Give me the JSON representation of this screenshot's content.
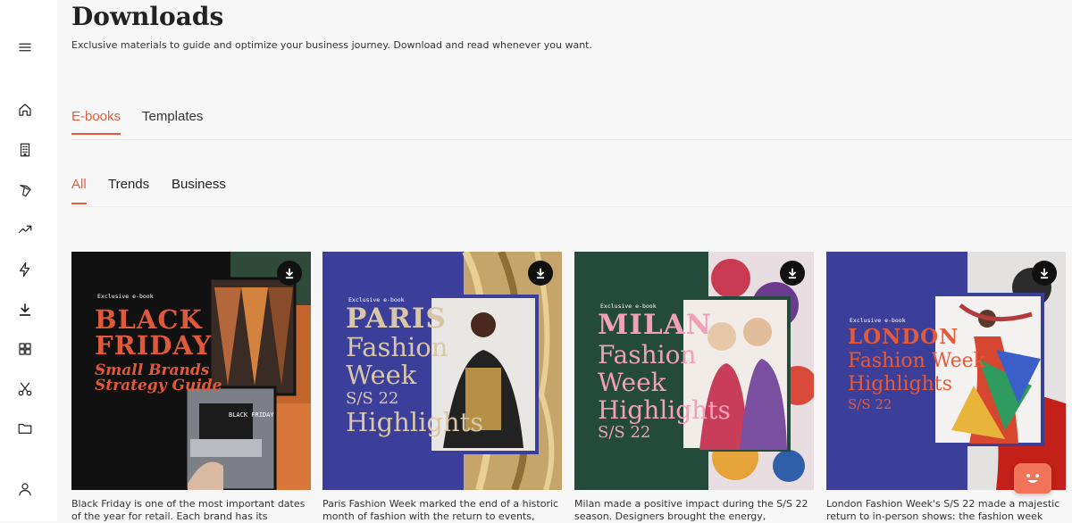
{
  "page": {
    "title": "Downloads",
    "subtitle": "Exclusive materials to guide and optimize your business journey. Download and read whenever you want."
  },
  "sidebar": {
    "items": [
      {
        "icon": "menu-icon"
      },
      {
        "icon": "home-icon"
      },
      {
        "icon": "building-icon"
      },
      {
        "icon": "hanger-icon"
      },
      {
        "icon": "trending-icon"
      },
      {
        "icon": "flash-icon"
      },
      {
        "icon": "download-icon"
      },
      {
        "icon": "grid-icon"
      },
      {
        "icon": "scissors-icon"
      },
      {
        "icon": "folder-icon"
      },
      {
        "icon": "user-icon"
      }
    ]
  },
  "tabs": [
    {
      "label": "E-books",
      "active": true
    },
    {
      "label": "Templates",
      "active": false
    }
  ],
  "filters": [
    {
      "label": "All",
      "active": true
    },
    {
      "label": "Trends",
      "active": false
    },
    {
      "label": "Business",
      "active": false
    }
  ],
  "cards": [
    {
      "label": "Exclusive e-book",
      "heading": [
        "BLACK",
        "FRIDAY"
      ],
      "subheading": [
        "Small Brands",
        "Strategy Guide"
      ],
      "laptop_screen": "BLACK FRIDAY",
      "description": "Black Friday is one of the most important dates of the year for retail. Each brand has its",
      "colors": {
        "bg": "#111111",
        "accent": "#e0593a"
      }
    },
    {
      "label": "Exclusive e-book",
      "heading": [
        "PARIS"
      ],
      "subheading": [
        "Fashion",
        "Week",
        "S/S 22",
        "Highlights"
      ],
      "description": "Paris Fashion Week marked the end of a historic month of fashion with the return to events,",
      "colors": {
        "bg": "#3c3f9a",
        "accent": "#d9c9a8"
      }
    },
    {
      "label": "Exclusive e-book",
      "heading": [
        "MILAN"
      ],
      "subheading": [
        "Fashion",
        "Week",
        "Highlights",
        "S/S 22"
      ],
      "description": "Milan made a positive impact during the S/S 22 season. Designers brought the energy,",
      "colors": {
        "bg": "#234a3b",
        "accent": "#f2a0b8"
      }
    },
    {
      "label": "Exclusive e-book",
      "heading": [
        "LONDON"
      ],
      "subheading": [
        "Fashion Week",
        "Highlights",
        "S/S 22"
      ],
      "description": "London Fashion Week's S/S 22 made a majestic return to in-person shows: the fashion week",
      "colors": {
        "bg": "#3c3f9a",
        "accent": "#e35b3a"
      }
    }
  ]
}
